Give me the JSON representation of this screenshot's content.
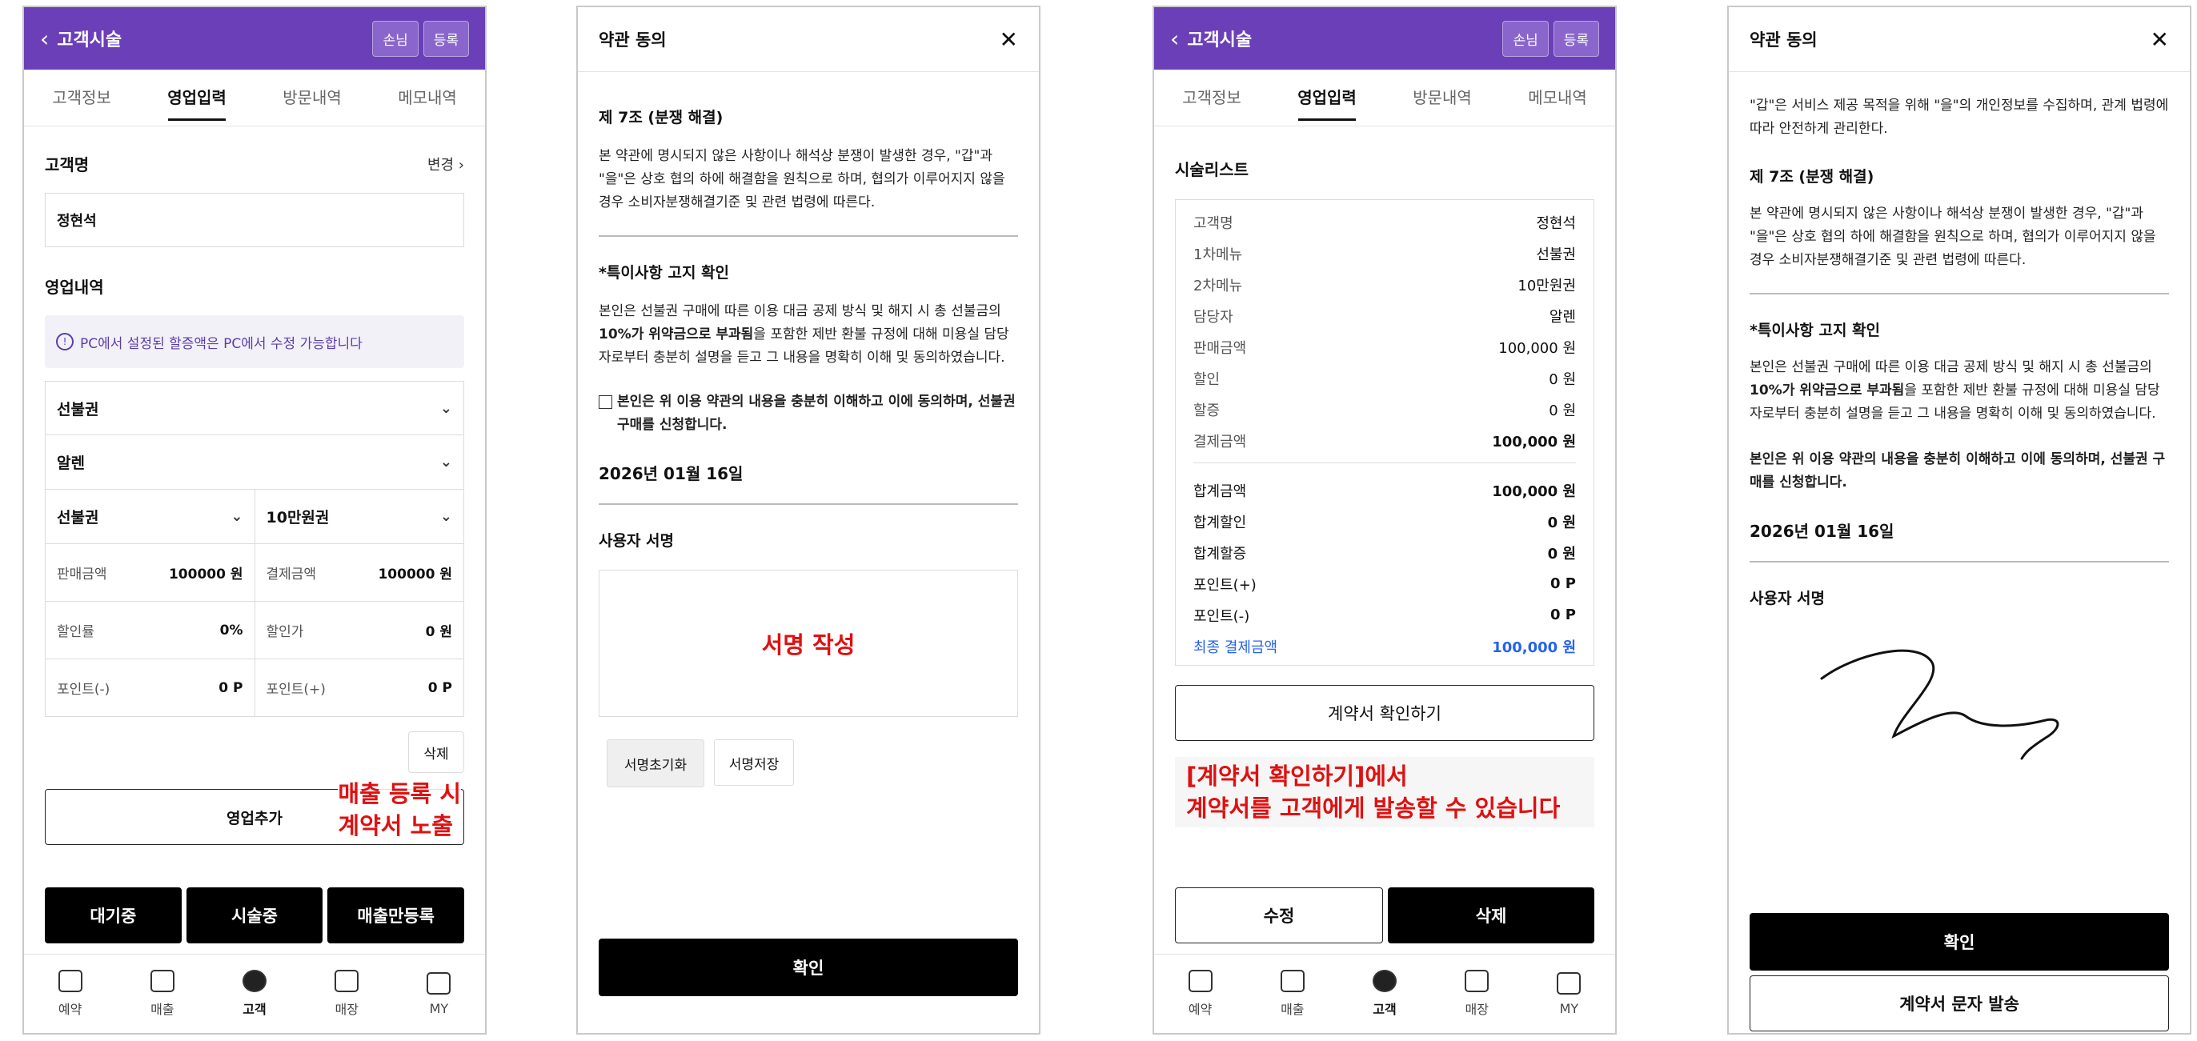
{
  "screen1": {
    "header": {
      "title": "고객시술",
      "btn_guest": "손님",
      "btn_register": "등록"
    },
    "tabs": [
      "고객정보",
      "영업입력",
      "방문내역",
      "메모내역"
    ],
    "customer_label": "고객명",
    "change_label": "변경",
    "customer_name": "정현석",
    "sales_title": "영업내역",
    "info_notice": "PC에서 설정된 할증액은 PC에서 수정 가능합니다",
    "select_type": "선불권",
    "select_staff": "알렌",
    "select_menu1": "선불권",
    "select_menu2": "10만원권",
    "sale_price_label": "판매금액",
    "sale_price": "100000 원",
    "pay_price_label": "결제금액",
    "pay_price": "100000 원",
    "discount_rate_label": "할인률",
    "discount_rate": "0%",
    "discount_price_label": "할인가",
    "discount_price": "0 원",
    "point_minus_label": "포인트(-)",
    "point_minus": "0 P",
    "point_plus_label": "포인트(+)",
    "point_plus": "0 P",
    "delete_btn": "삭제",
    "add_sales_btn": "영업추가",
    "annotation_line1": "매출 등록 시",
    "annotation_line2": "계약서 노출",
    "btn_waiting": "대기중",
    "btn_in_progress": "시술중",
    "btn_sales_only": "매출만등록"
  },
  "nav": [
    "예약",
    "매출",
    "고객",
    "매장",
    "MY"
  ],
  "screen2": {
    "title": "약관 동의",
    "article_title": "제 7조 (분쟁 해결)",
    "article_text": "본 약관에 명시되지 않은 사항이나 해석상 분쟁이 발생한 경우, \"갑\"과 \"을\"은 상호 협의 하에 해결함을 원칙으로 하며, 협의가 이루어지지 않을 경우 소비자분쟁해결기준 및 관련 법령에 따른다.",
    "special_title": "*특이사항 고지 확인",
    "special_pre": "본인은 선불권 구매에 따른 이용 대금 공제 방식 및 해지 시 총 선불금의 ",
    "special_bold": "10%가 위약금으로 부과됨",
    "special_post": "을 포함한 제반 환불 규정에 대해 미용실 담당자로부터 충분히 설명을 듣고 그 내용을 명확히 이해 및 동의하였습니다.",
    "agree_text": "본인은 위 이용 약관의 내용을 충분히 이해하고 이에 동의하며, 선불권 구매를 신청합니다.",
    "date": "2026년 01월 16일",
    "sign_title": "사용자 서명",
    "sign_placeholder": "서명 작성",
    "btn_reset": "서명초기화",
    "btn_save": "서명저장",
    "btn_confirm": "확인"
  },
  "screen3": {
    "header": {
      "title": "고객시술",
      "btn_guest": "손님",
      "btn_register": "등록"
    },
    "tabs": [
      "고객정보",
      "영업입력",
      "방문내역",
      "메모내역"
    ],
    "list_title": "시술리스트",
    "rows": [
      [
        "고객명",
        "정현석"
      ],
      [
        "1차메뉴",
        "선불권"
      ],
      [
        "2차메뉴",
        "10만원권"
      ],
      [
        "담당자",
        "알렌"
      ],
      [
        "판매금액",
        "100,000 원"
      ],
      [
        "할인",
        "0 원"
      ],
      [
        "할증",
        "0 원"
      ],
      [
        "결제금액",
        "100,000 원"
      ]
    ],
    "totals": [
      [
        "합계금액",
        "100,000 원"
      ],
      [
        "합계할인",
        "0 원"
      ],
      [
        "합계할증",
        "0 원"
      ],
      [
        "포인트(+)",
        "0 P"
      ],
      [
        "포인트(-)",
        "0 P"
      ]
    ],
    "final_label": "최종 결제금액",
    "final_value": "100,000 원",
    "contract_btn": "계약서 확인하기",
    "annotation_line1": "[계약서 확인하기]에서",
    "annotation_line2": "계약서를 고객에게 발송할 수 있습니다",
    "btn_edit": "수정",
    "btn_delete": "삭제"
  },
  "screen4": {
    "title": "약관 동의",
    "privacy_text": "\"갑\"은 서비스 제공 목적을 위해 \"을\"의 개인정보를 수집하며, 관계 법령에 따라 안전하게 관리한다.",
    "article_title": "제 7조 (분쟁 해결)",
    "article_text": "본 약관에 명시되지 않은 사항이나 해석상 분쟁이 발생한 경우, \"갑\"과 \"을\"은 상호 협의 하에 해결함을 원칙으로 하며, 협의가 이루어지지 않을 경우 소비자분쟁해결기준 및 관련 법령에 따른다.",
    "special_title": "*특이사항 고지 확인",
    "special_pre": "본인은 선불권 구매에 따른 이용 대금 공제 방식 및 해지 시 총 선불금의 ",
    "special_bold": "10%가 위약금으로 부과됨",
    "special_post": "을 포함한 제반 환불 규정에 대해 미용실 담당자로부터 충분히 설명을 듣고 그 내용을 명확히 이해 및 동의하였습니다.",
    "agree_text": "본인은 위 이용 약관의 내용을 충분히 이해하고 이에 동의하며, 선불권 구매를 신청합니다.",
    "date": "2026년 01월 16일",
    "sign_title": "사용자 서명",
    "btn_confirm": "확인",
    "btn_send_sms": "계약서 문자 발송"
  },
  "colors": {
    "purple": "#6a3fb8",
    "annotation_red": "#e01010",
    "link_blue": "#2563eb"
  }
}
